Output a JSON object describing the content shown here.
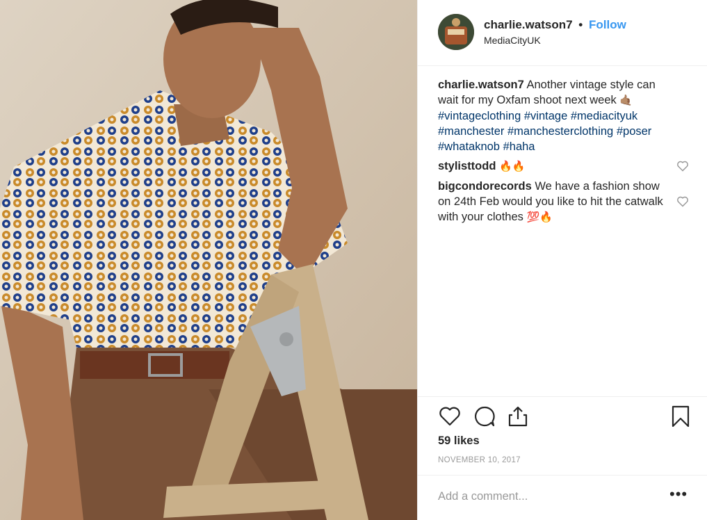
{
  "post": {
    "header": {
      "username": "charlie.watson7",
      "separator": "•",
      "follow_label": "Follow",
      "location": "MediaCityUK",
      "avatar_icon": "profile-avatar"
    },
    "caption": {
      "username": "charlie.watson7",
      "text": "Another vintage style can wait for my Oxfam shoot next week",
      "emoji": "🤙🏽",
      "hashtags": [
        "#vintageclothing",
        "#vintage",
        "#mediacityuk",
        "#manchester",
        "#manchesterclothing",
        "#poser",
        "#whataknob",
        "#haha"
      ]
    },
    "comments": [
      {
        "username": "stylisttodd",
        "text": "",
        "emoji": "🔥🔥"
      },
      {
        "username": "bigcondorecords",
        "text": "We have a fashion show on 24th Feb would you like to hit the catwalk with your clothes",
        "emoji": "💯🔥"
      }
    ],
    "actions": {
      "like_icon": "heart-icon",
      "comment_icon": "comment-icon",
      "share_icon": "share-icon",
      "save_icon": "bookmark-icon"
    },
    "likes": "59 likes",
    "date": "NOVEMBER 10, 2017",
    "add_comment_placeholder": "Add a comment...",
    "more_label": "•••",
    "colors": {
      "follow": "#3897f0",
      "hashtag": "#003569",
      "muted": "#999999",
      "text": "#262626"
    }
  }
}
